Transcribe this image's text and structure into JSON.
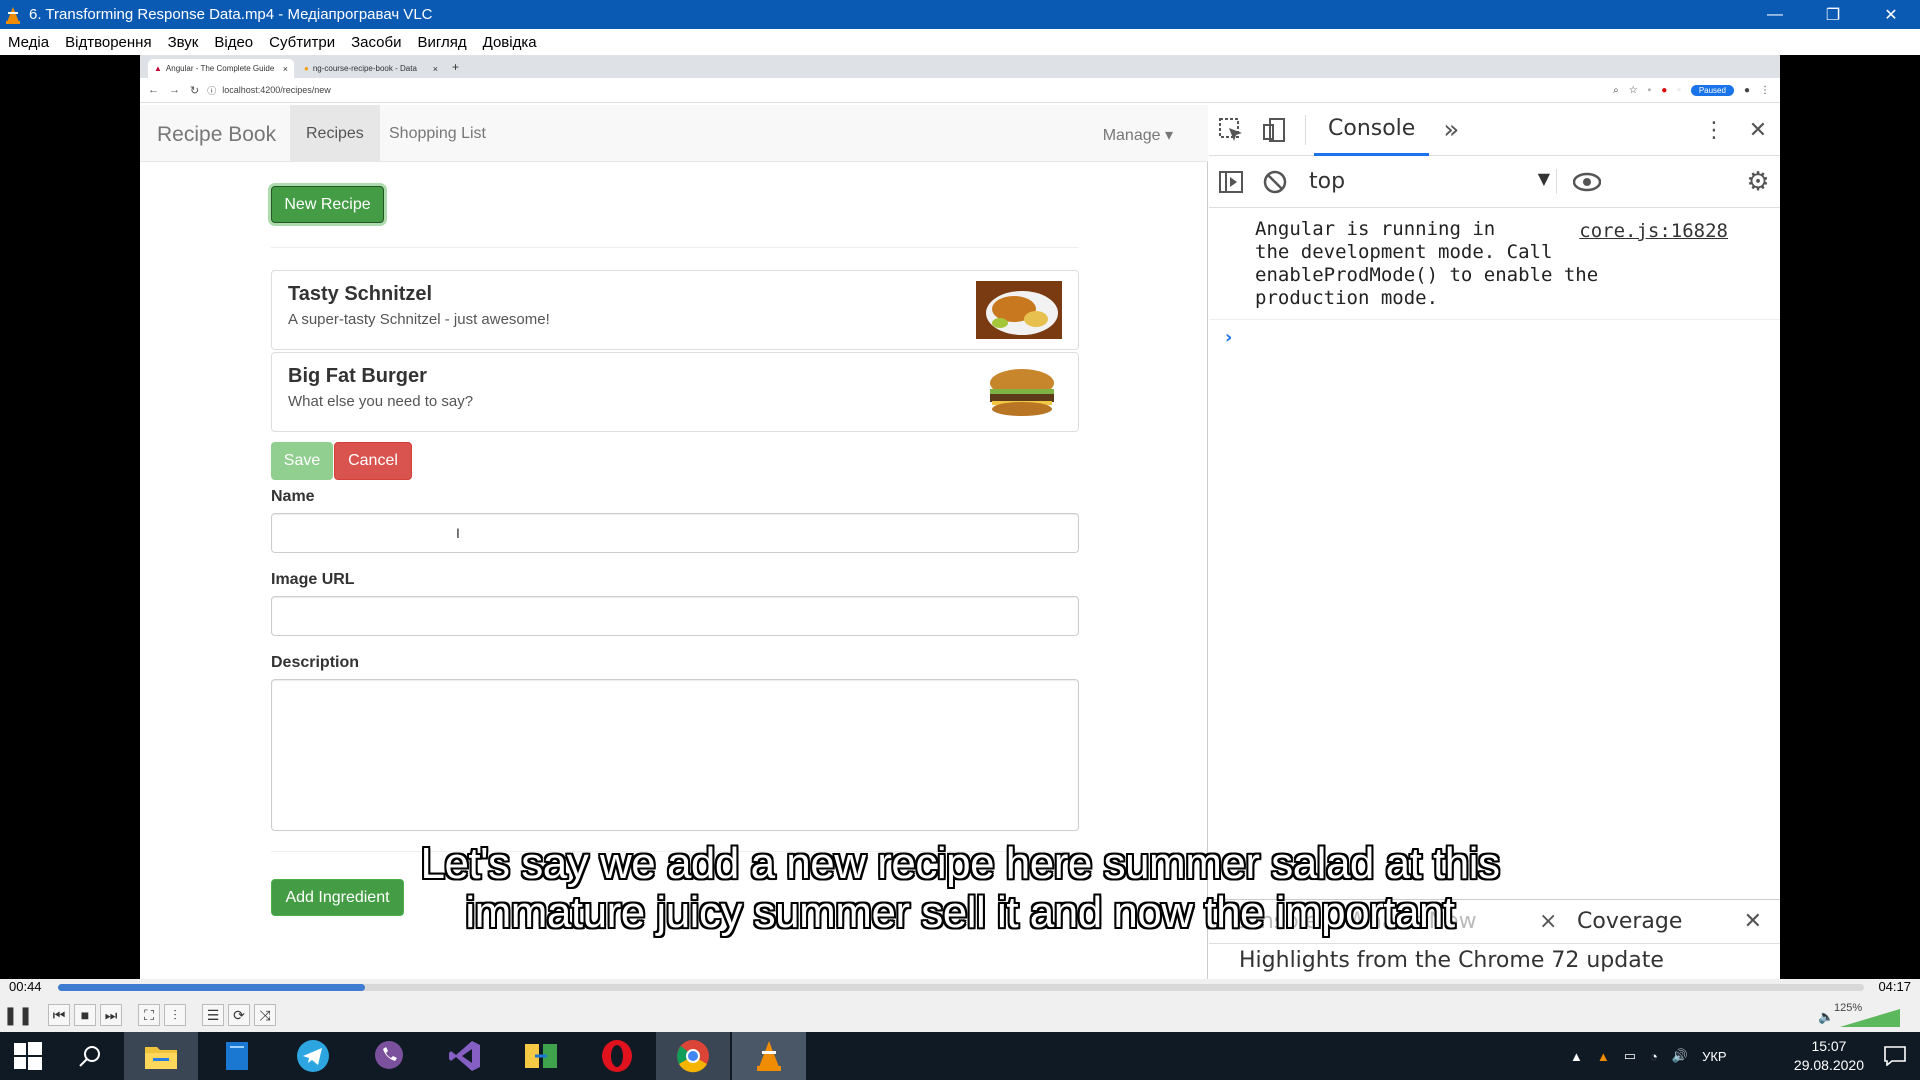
{
  "window": {
    "title": "6. Transforming Response Data.mp4 - Медіапрогравач VLC",
    "minimize": "—",
    "restore": "❐",
    "close": "✕"
  },
  "menu": [
    "Медіа",
    "Відтворення",
    "Звук",
    "Відео",
    "Субтитри",
    "Засоби",
    "Вигляд",
    "Довідка"
  ],
  "browser": {
    "tabs": [
      {
        "label": "Angular - The Complete Guide",
        "close": "×"
      },
      {
        "label": "ng-course-recipe-book - Data",
        "close": "×"
      }
    ],
    "new_tab": "+",
    "url": "localhost:4200/recipes/new",
    "paused_label": "Paused"
  },
  "app": {
    "brand": "Recipe Book",
    "nav": [
      {
        "label": "Recipes"
      },
      {
        "label": "Shopping List"
      }
    ],
    "manage": "Manage ▾",
    "new_recipe": "New Recipe",
    "recipes": [
      {
        "name": "Tasty Schnitzel",
        "description": "A super-tasty Schnitzel - just awesome!"
      },
      {
        "name": "Big Fat Burger",
        "description": "What else you need to say?"
      }
    ],
    "save": "Save",
    "cancel": "Cancel",
    "form": {
      "name_label": "Name",
      "image_label": "Image URL",
      "description_label": "Description",
      "name_value": "",
      "image_value": "",
      "description_value": ""
    },
    "add_ingredient": "Add Ingredient"
  },
  "devtools": {
    "tab": "Console",
    "more": "»",
    "context": "top",
    "context_arrow": "▼",
    "message_lines": [
      "Angular is running in",
      "the development mode. Call",
      "enableProdMode() to enable the",
      "production mode."
    ],
    "message_source": "core.js:16828",
    "prompt": "›",
    "drawer_tab_hidden": "Console    What's New",
    "drawer_close": "×",
    "drawer_coverage": "Coverage",
    "drawer_close2": "✕",
    "drawer_text": "Highlights from the Chrome 72 update"
  },
  "subtitles": [
    "Let's say we add a new recipe here summer salad at this",
    "immature juicy summer sell it and now the important"
  ],
  "player": {
    "elapsed": "00:44",
    "total": "04:17",
    "progress": 0.17,
    "volume": "125%",
    "volume_level": 1.25
  },
  "taskbar": {
    "language": "УКР",
    "time": "15:07",
    "date": "29.08.2020"
  },
  "colors": {
    "vlc_title": "#0a5ab4",
    "success": "#5cb85c",
    "danger": "#d9534f",
    "devtools_accent": "#1a73e8"
  }
}
